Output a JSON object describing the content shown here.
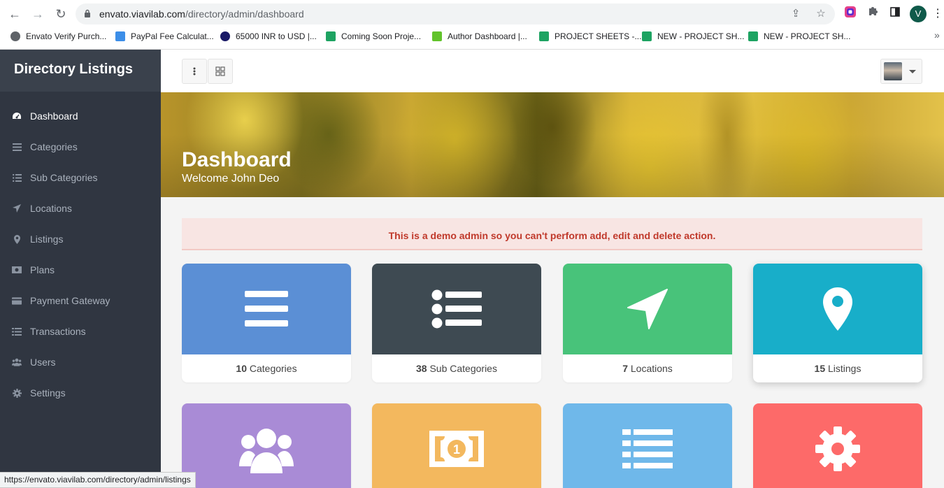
{
  "browser": {
    "url_host": "envato.viavilab.com",
    "url_path": "/directory/admin/dashboard",
    "profile_initial": "V",
    "bookmarks": [
      {
        "label": "Envato Verify Purch...",
        "color": "#5f6368"
      },
      {
        "label": "PayPal Fee Calculat...",
        "color": "#3c8ee8"
      },
      {
        "label": "65000 INR to USD |...",
        "color": "#1a1a66"
      },
      {
        "label": "Coming Soon Proje...",
        "color": "#1ea362"
      },
      {
        "label": "Author Dashboard |...",
        "color": "#62c32c"
      },
      {
        "label": "PROJECT SHEETS -...",
        "color": "#1ea362"
      },
      {
        "label": "NEW - PROJECT SH...",
        "color": "#1ea362"
      },
      {
        "label": "NEW - PROJECT SH...",
        "color": "#1ea362"
      }
    ]
  },
  "sidebar": {
    "brand": "Directory Listings",
    "items": [
      {
        "label": "Dashboard",
        "icon": "dashboard-icon",
        "active": true
      },
      {
        "label": "Categories",
        "icon": "bars-icon"
      },
      {
        "label": "Sub Categories",
        "icon": "list-icon"
      },
      {
        "label": "Locations",
        "icon": "location-arrow-icon"
      },
      {
        "label": "Listings",
        "icon": "map-marker-icon"
      },
      {
        "label": "Plans",
        "icon": "money-icon"
      },
      {
        "label": "Payment Gateway",
        "icon": "credit-card-icon"
      },
      {
        "label": "Transactions",
        "icon": "list-alt-icon"
      },
      {
        "label": "Users",
        "icon": "users-icon"
      },
      {
        "label": "Settings",
        "icon": "cog-icon"
      }
    ]
  },
  "hero": {
    "title": "Dashboard",
    "subtitle": "Welcome John Deo"
  },
  "alert": "This is a demo admin so you can't perform add, edit and delete action.",
  "cards": [
    {
      "count": "10",
      "label": "Categories",
      "color": "#5b8fd5",
      "icon": "bars-icon"
    },
    {
      "count": "38",
      "label": "Sub Categories",
      "color": "#3e4a52",
      "icon": "list-icon"
    },
    {
      "count": "7",
      "label": "Locations",
      "color": "#48c37a",
      "icon": "location-arrow-icon"
    },
    {
      "count": "15",
      "label": "Listings",
      "color": "#18aec9",
      "icon": "map-marker-icon"
    },
    {
      "color": "#a98bd6",
      "icon": "users-icon"
    },
    {
      "color": "#f3b85e",
      "icon": "money-icon"
    },
    {
      "color": "#6fb8ea",
      "icon": "list-alt-icon"
    },
    {
      "color": "#fd6a69",
      "icon": "cog-icon"
    }
  ],
  "status_url": "https://envato.viavilab.com/directory/admin/listings"
}
